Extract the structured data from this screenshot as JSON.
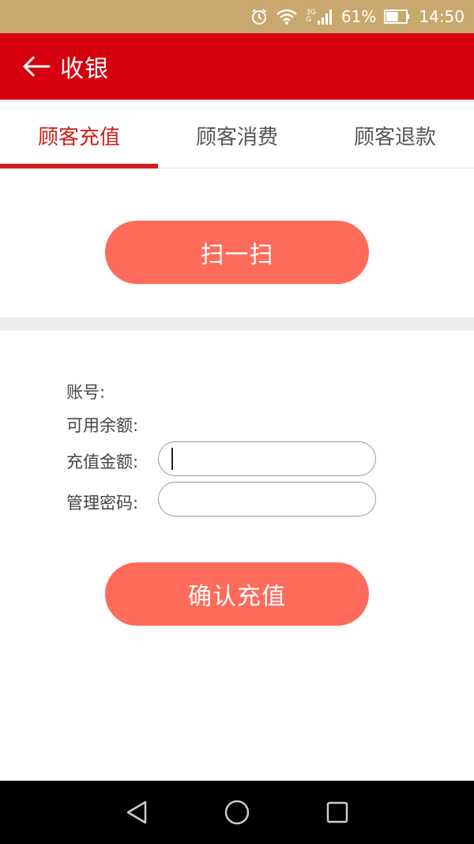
{
  "status_bar": {
    "network_type_top": "3G",
    "network_type_bottom": "G",
    "battery_percent": "61%",
    "battery_level": 0.61,
    "time": "14:50",
    "icons": [
      "alarm-icon",
      "wifi-icon",
      "signal-icon",
      "battery-icon"
    ]
  },
  "app_bar": {
    "back_icon": "arrow-left-icon",
    "title": "收银",
    "color": "#d7000f"
  },
  "tabs": [
    {
      "label": "顾客充值",
      "active": true
    },
    {
      "label": "顾客消费",
      "active": false
    },
    {
      "label": "顾客退款",
      "active": false
    }
  ],
  "scan": {
    "button_label": "扫一扫"
  },
  "form": {
    "account_label": "账号:",
    "available_balance_label": "可用余额:",
    "recharge_amount_label": "充值金额:",
    "recharge_amount_value": "",
    "admin_password_label": "管理密码:",
    "admin_password_value": "",
    "confirm_button_label": "确认充值"
  },
  "nav_bar": {
    "icons": [
      "back-triangle-icon",
      "home-circle-icon",
      "recents-square-icon"
    ]
  },
  "colors": {
    "accent_red": "#d31c1c",
    "button_coral": "#fe6b5a",
    "status_bar_gold": "#c8a86e"
  }
}
